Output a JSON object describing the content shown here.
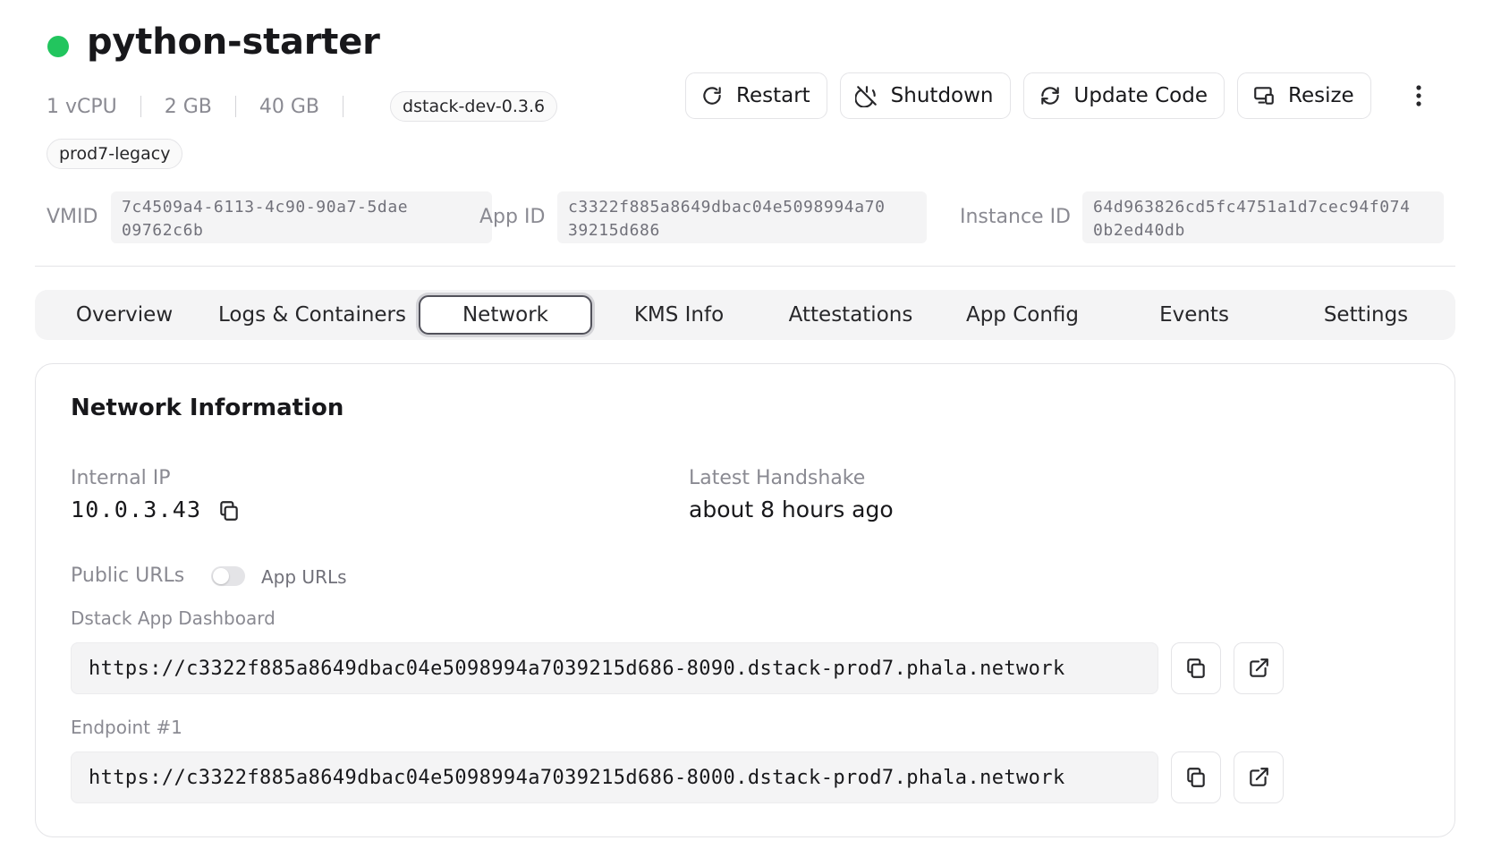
{
  "header": {
    "app_name": "python-starter",
    "status_color": "#22c55e",
    "specs": {
      "vcpu": "1 vCPU",
      "memory": "2 GB",
      "disk": "40 GB"
    },
    "image_version": "dstack-dev-0.3.6",
    "cluster_tag": "prod7-legacy"
  },
  "actions": {
    "restart": "Restart",
    "shutdown": "Shutdown",
    "update_code": "Update Code",
    "resize": "Resize",
    "more_icon": "more-vertical-icon"
  },
  "identifiers": {
    "vmid_label": "VMID",
    "vmid_line1": "7c4509a4-6113-4c90-90a7-5dae",
    "vmid_line2": "09762c6b",
    "app_id_label": "App ID",
    "app_id_line1": "c3322f885a8649dbac04e5098994a70",
    "app_id_line2": "39215d686",
    "instance_id_label": "Instance ID",
    "instance_id_line1": "64d963826cd5fc4751a1d7cec94f074",
    "instance_id_line2": "0b2ed40db"
  },
  "tabs": [
    {
      "label": "Overview"
    },
    {
      "label": "Logs & Containers"
    },
    {
      "label": "Network",
      "active": true
    },
    {
      "label": "KMS Info"
    },
    {
      "label": "Attestations"
    },
    {
      "label": "App Config"
    },
    {
      "label": "Events"
    },
    {
      "label": "Settings"
    }
  ],
  "network": {
    "title": "Network Information",
    "internal_ip_label": "Internal IP",
    "internal_ip": "10.0.3.43",
    "handshake_label": "Latest Handshake",
    "handshake": "about 8 hours ago",
    "public_urls_label": "Public URLs",
    "toggle_label": "App URLs",
    "toggle_on": false,
    "endpoints": [
      {
        "label": "Dstack App Dashboard",
        "url": "https://c3322f885a8649dbac04e5098994a7039215d686-8090.dstack-prod7.phala.network"
      },
      {
        "label": "Endpoint #1",
        "url": "https://c3322f885a8649dbac04e5098994a7039215d686-8000.dstack-prod7.phala.network"
      }
    ]
  }
}
